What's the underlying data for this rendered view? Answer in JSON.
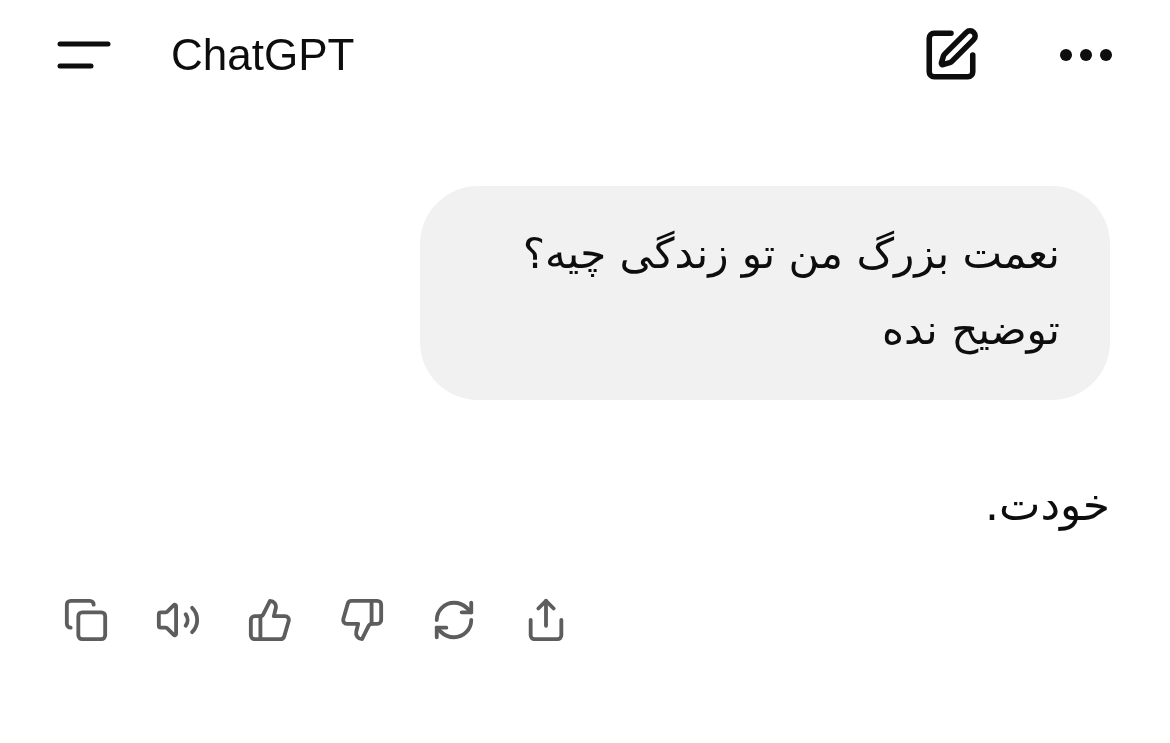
{
  "header": {
    "title": "ChatGPT"
  },
  "messages": [
    {
      "kind": "user",
      "text": "نعمت بزرگ من تو زندگی چیه؟ توضیح نده"
    },
    {
      "kind": "assistant",
      "text": "خودت."
    }
  ]
}
